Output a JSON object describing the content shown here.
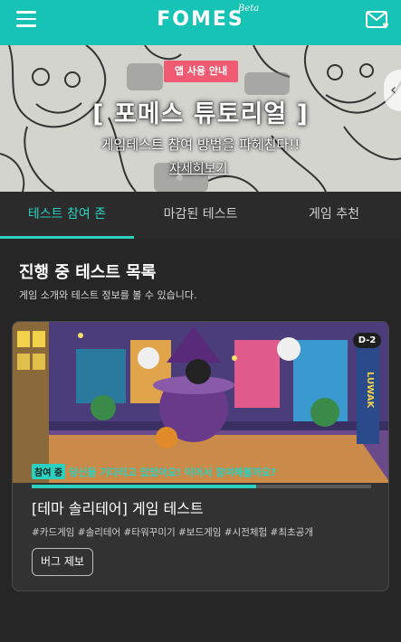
{
  "header": {
    "logo": "FOMES",
    "beta": "Beta",
    "menu_icon": "hamburger-menu-icon",
    "mail_icon": "mail-heart-icon",
    "bg_color": "#17c3b4"
  },
  "banner": {
    "badge": "앱 사용 안내",
    "title": "[ 포메스 튜토리얼 ]",
    "subtitle": "게임테스트 참여 방법을 파헤친다!!",
    "link": "자세히보기",
    "arrow": "‹",
    "badge_color": "#f05a72"
  },
  "tabs": [
    {
      "label": "테스트 참여 존",
      "active": true
    },
    {
      "label": "마감된 테스트",
      "active": false
    },
    {
      "label": "게임 추천",
      "active": false
    }
  ],
  "section": {
    "title": "진행 중 테스트 목록",
    "description": "게임 소개와 테스트 정보를 볼 수 있습니다."
  },
  "card": {
    "dday": "D-2",
    "status_badge": "참여 중",
    "status_text": "당신을 기다리고 있었어요! 이어서 참여해볼까요?",
    "progress": 0.66,
    "title": "[테마 솔리테어] 게임 테스트",
    "tags": "#카드게임 #솔리테어 #타워꾸미기 #보드게임 #시전체험 #최초공개",
    "button": "버그 제보",
    "accent_color": "#2bd1c0",
    "sign_text": "LUWAK"
  }
}
